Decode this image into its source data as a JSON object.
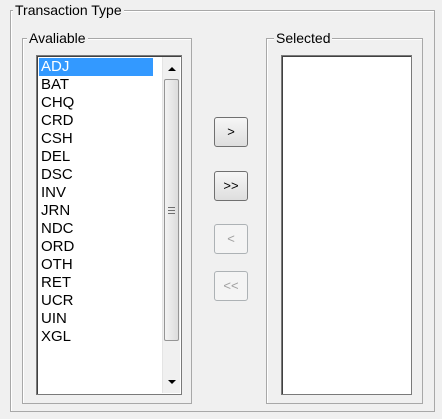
{
  "transaction_type": {
    "label": "Transaction Type",
    "available": {
      "label": "Avaliable",
      "items": [
        "ADJ",
        "BAT",
        "CHQ",
        "CRD",
        "CSH",
        "DEL",
        "DSC",
        "INV",
        "JRN",
        "NDC",
        "ORD",
        "OTH",
        "RET",
        "UCR",
        "UIN",
        "XGL"
      ],
      "selected_item": "ADJ"
    },
    "selected": {
      "label": "Selected",
      "items": []
    },
    "buttons": {
      "add_label": ">",
      "add_all_label": ">>",
      "remove_label": "<",
      "remove_all_label": "<<"
    }
  },
  "colors": {
    "selection_highlight": "#3399ff",
    "disabled_text": "#a0a0a0"
  }
}
